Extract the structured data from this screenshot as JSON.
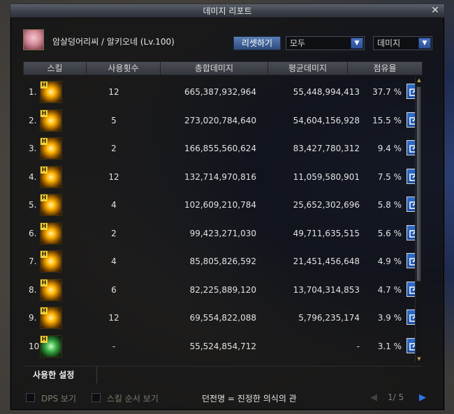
{
  "window": {
    "title": "데미지 리포트",
    "close": "✕"
  },
  "header": {
    "character": "암살덩어리씨 / 알키오네 (Lv.100)",
    "reset_label": "리셋하기",
    "filter_value": "모두",
    "metric_value": "데미지",
    "dropdown_arrow": "▼"
  },
  "table": {
    "columns": [
      "스킬",
      "사용횟수",
      "총합데미지",
      "평균데미지",
      "점유율"
    ],
    "rows": [
      {
        "rank": "1.",
        "uses": "12",
        "total": "665,387,932,964",
        "avg": "55,448,994,413",
        "pct": "37.7 %",
        "icon": "gold-burst-skill-icon"
      },
      {
        "rank": "2.",
        "uses": "5",
        "total": "273,020,784,640",
        "avg": "54,604,156,928",
        "pct": "15.5 %",
        "icon": "gold-flame-skill-icon"
      },
      {
        "rank": "3.",
        "uses": "2",
        "total": "166,855,560,624",
        "avg": "83,427,780,312",
        "pct": "9.4 %",
        "icon": "gold-star-skill-icon"
      },
      {
        "rank": "4.",
        "uses": "12",
        "total": "132,714,970,816",
        "avg": "11,059,580,901",
        "pct": "7.5 %",
        "icon": "gold-lightning-skill-icon"
      },
      {
        "rank": "5.",
        "uses": "4",
        "total": "102,609,210,784",
        "avg": "25,652,302,696",
        "pct": "5.8 %",
        "icon": "gold-slash-skill-icon"
      },
      {
        "rank": "6.",
        "uses": "2",
        "total": "99,423,271,030",
        "avg": "49,711,635,515",
        "pct": "5.6 %",
        "icon": "gold-sun-skill-icon"
      },
      {
        "rank": "7.",
        "uses": "4",
        "total": "85,805,826,592",
        "avg": "21,451,456,648",
        "pct": "4.9 %",
        "icon": "gold-wave-skill-icon"
      },
      {
        "rank": "8.",
        "uses": "6",
        "total": "82,225,889,120",
        "avg": "13,704,314,853",
        "pct": "4.7 %",
        "icon": "gold-crescent-skill-icon"
      },
      {
        "rank": "9.",
        "uses": "12",
        "total": "69,554,822,088",
        "avg": "5,796,235,174",
        "pct": "3.9 %",
        "icon": "gold-tornado-skill-icon"
      },
      {
        "rank": "10.",
        "uses": "-",
        "total": "55,524,854,712",
        "avg": "-",
        "pct": "3.1 %",
        "icon": "green-sprite-skill-icon"
      }
    ],
    "icon_badge": "H"
  },
  "tabs": {
    "used_settings": "사용한 설정"
  },
  "footer": {
    "dps_label": "DPS 보기",
    "order_label": "스킬 순서 보기",
    "dungeon": "던전명 = 진정한 의식의 관",
    "page": "1/ 5",
    "prev": "◀",
    "next": "▶"
  },
  "colors": {
    "accent_blue": "#2d6fd0",
    "window_bg": "#0e0e10"
  }
}
